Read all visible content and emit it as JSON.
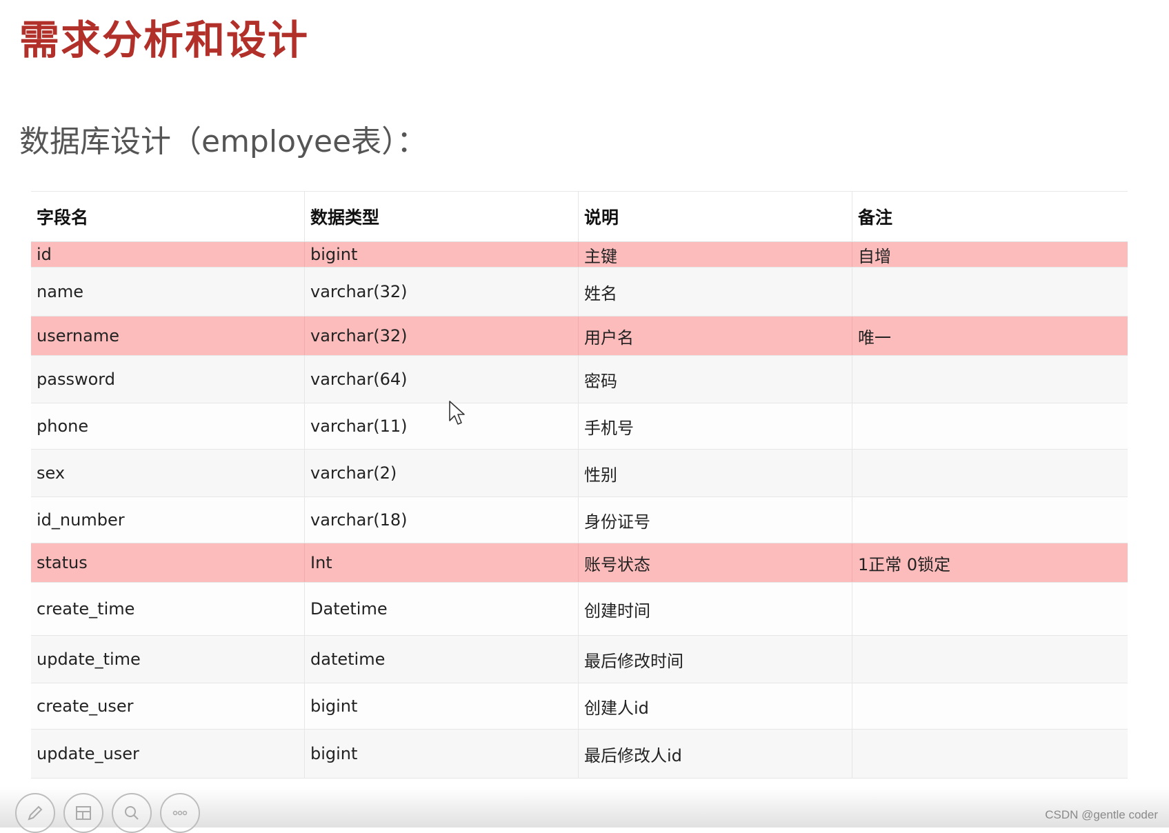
{
  "slide": {
    "title": "需求分析和设计",
    "subtitle": "数据库设计（employee表）："
  },
  "table": {
    "headers": [
      "字段名",
      "数据类型",
      "说明",
      "备注"
    ],
    "rows": [
      {
        "field": "id",
        "type": "bigint",
        "desc": "主键",
        "note": "自增",
        "highlighted": true
      },
      {
        "field": "name",
        "type": "varchar(32)",
        "desc": "姓名",
        "note": "",
        "highlighted": false
      },
      {
        "field": "username",
        "type": "varchar(32)",
        "desc": "用户名",
        "note": "唯一",
        "highlighted": true
      },
      {
        "field": "password",
        "type": "varchar(64)",
        "desc": "密码",
        "note": "",
        "highlighted": false
      },
      {
        "field": "phone",
        "type": "varchar(11)",
        "desc": "手机号",
        "note": "",
        "highlighted": false
      },
      {
        "field": "sex",
        "type": "varchar(2)",
        "desc": "性别",
        "note": "",
        "highlighted": false
      },
      {
        "field": "id_number",
        "type": "varchar(18)",
        "desc": "身份证号",
        "note": "",
        "highlighted": false
      },
      {
        "field": "status",
        "type": "Int",
        "desc": "账号状态",
        "note": "1正常 0锁定",
        "highlighted": true
      },
      {
        "field": "create_time",
        "type": "Datetime",
        "desc": "创建时间",
        "note": "",
        "highlighted": false
      },
      {
        "field": "update_time",
        "type": "datetime",
        "desc": "最后修改时间",
        "note": "",
        "highlighted": false
      },
      {
        "field": "create_user",
        "type": "bigint",
        "desc": "创建人id",
        "note": "",
        "highlighted": false
      },
      {
        "field": "update_user",
        "type": "bigint",
        "desc": "最后修改人id",
        "note": "",
        "highlighted": false
      }
    ]
  },
  "toolbar": {
    "icons": [
      "pen-icon",
      "layout-icon",
      "zoom-icon",
      "more-icon"
    ]
  },
  "watermark": "CSDN @gentle coder",
  "colors": {
    "title": "#b2302a",
    "highlight_row": "#fdbcbc"
  }
}
